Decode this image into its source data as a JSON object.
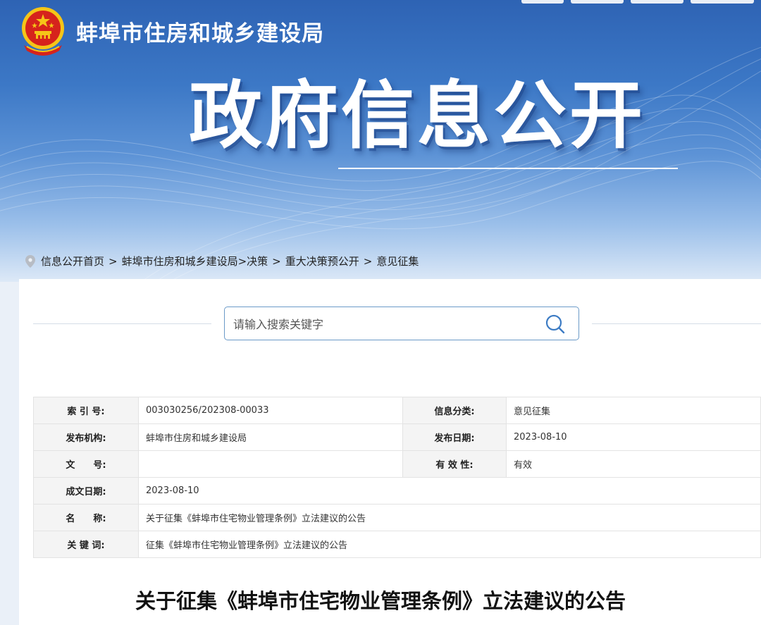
{
  "header": {
    "site_title": "蚌埠市住房和城乡建设局",
    "banner_title": "政府信息公开",
    "emblem": "national-emblem"
  },
  "breadcrumb": {
    "icon": "location-pin-icon",
    "items": [
      "信息公开首页",
      "蚌埠市住房和城乡建设局>决策",
      "重大决策预公开",
      "意见征集"
    ],
    "separator": ">"
  },
  "search": {
    "placeholder": "请输入搜索关键字",
    "value": "",
    "icon": "search-icon"
  },
  "meta": {
    "index_no_label": "索 引 号:",
    "index_no": "003030256/202308-00033",
    "category_label": "信息分类:",
    "category": "意见征集",
    "publisher_label": "发布机构:",
    "publisher": "蚌埠市住房和城乡建设局",
    "pub_date_label": "发布日期:",
    "pub_date": "2023-08-10",
    "doc_no_label": "文　　号:",
    "doc_no": "",
    "validity_label": "有 效 性:",
    "validity": "有效",
    "created_label": "成文日期:",
    "created": "2023-08-10",
    "name_label": "名　　称:",
    "name": "关于征集《蚌埠市住宅物业管理条例》立法建议的公告",
    "keywords_label": "关 键 词:",
    "keywords": "征集《蚌埠市住宅物业管理条例》立法建议的公告"
  },
  "article": {
    "title": "关于征集《蚌埠市住宅物业管理条例》立法建议的公告"
  },
  "colors": {
    "banner_top": "#2e63b4",
    "banner_bottom": "#dde9f7",
    "search_border": "#6b9ac8",
    "label_bg": "#f4f4f4"
  }
}
